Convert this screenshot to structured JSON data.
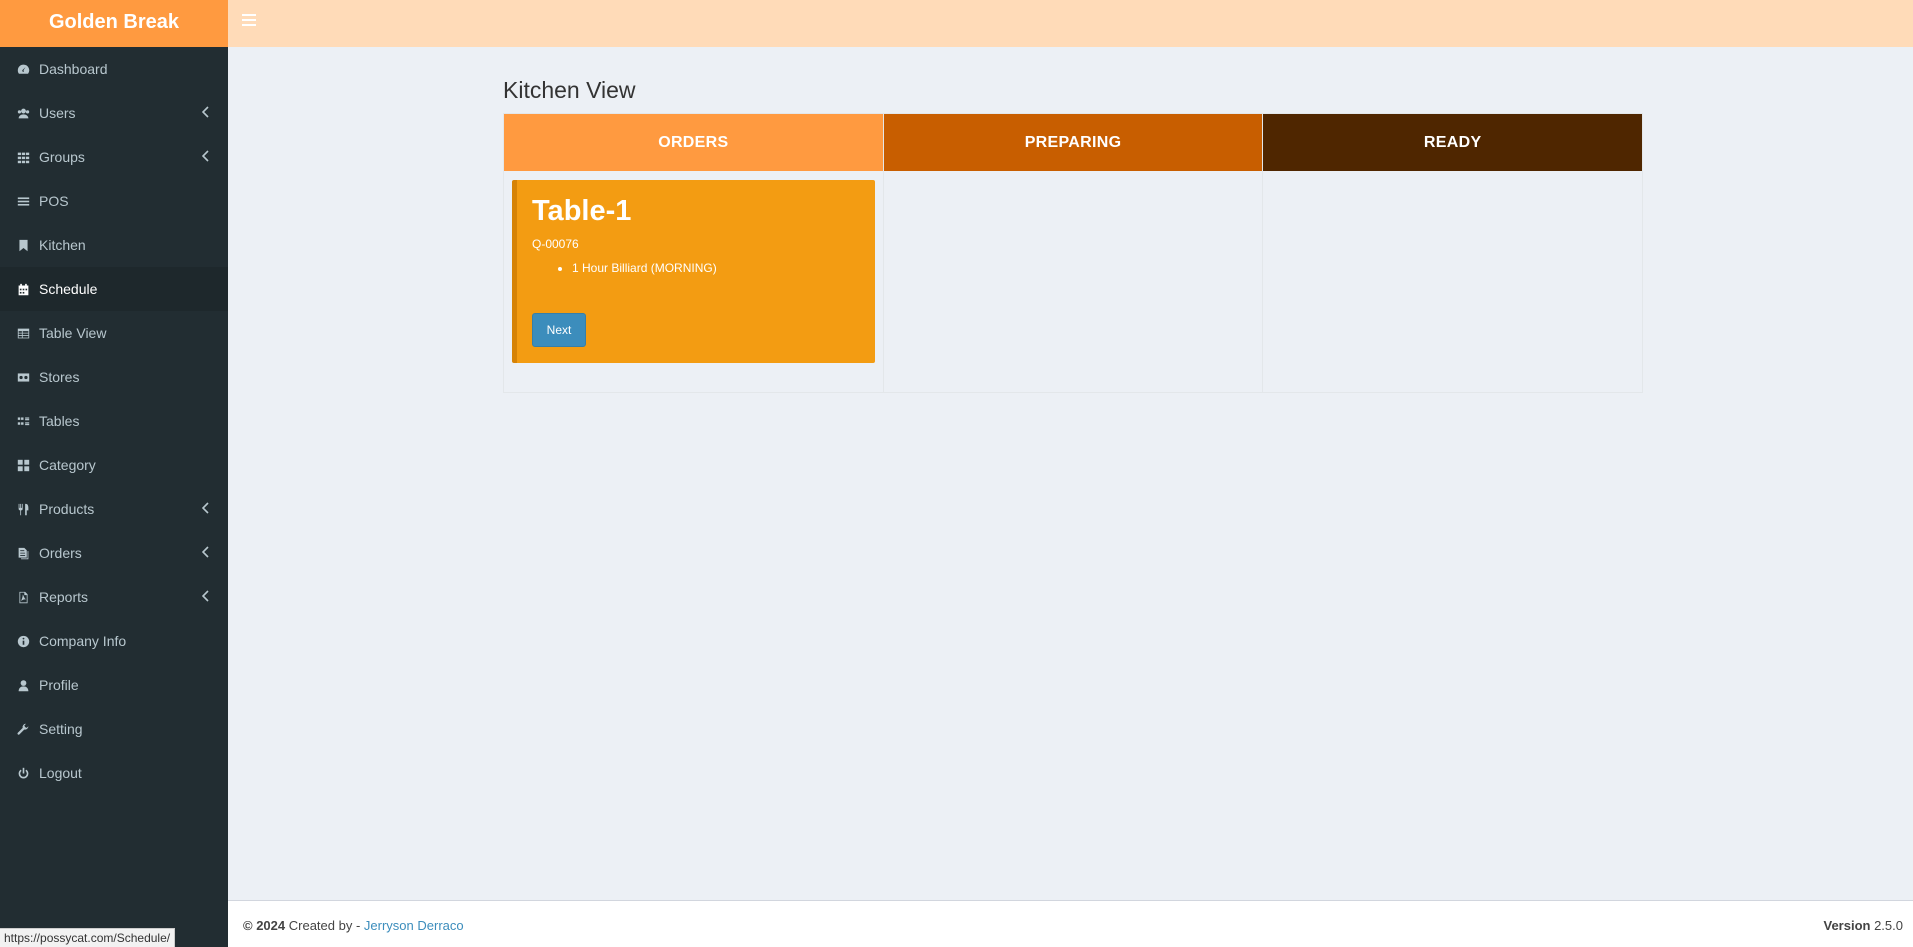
{
  "app": {
    "brand": "Golden Break"
  },
  "sidebar": {
    "items": [
      {
        "label": "Dashboard",
        "icon": "dashboard-icon",
        "has_caret": false,
        "active": false
      },
      {
        "label": "Users",
        "icon": "users-icon",
        "has_caret": true,
        "active": false
      },
      {
        "label": "Groups",
        "icon": "grid-icon",
        "has_caret": true,
        "active": false
      },
      {
        "label": "POS",
        "icon": "bars-icon",
        "has_caret": false,
        "active": false
      },
      {
        "label": "Kitchen",
        "icon": "bookmark-icon",
        "has_caret": false,
        "active": false
      },
      {
        "label": "Schedule",
        "icon": "calendar-icon",
        "has_caret": false,
        "active": true
      },
      {
        "label": "Table View",
        "icon": "table-icon",
        "has_caret": false,
        "active": false
      },
      {
        "label": "Stores",
        "icon": "store-icon",
        "has_caret": false,
        "active": false
      },
      {
        "label": "Tables",
        "icon": "tables-icon",
        "has_caret": false,
        "active": false
      },
      {
        "label": "Category",
        "icon": "category-icon",
        "has_caret": false,
        "active": false
      },
      {
        "label": "Products",
        "icon": "cutlery-icon",
        "has_caret": true,
        "active": false
      },
      {
        "label": "Orders",
        "icon": "files-icon",
        "has_caret": true,
        "active": false
      },
      {
        "label": "Reports",
        "icon": "pdf-file-icon",
        "has_caret": true,
        "active": false
      },
      {
        "label": "Company Info",
        "icon": "info-icon",
        "has_caret": false,
        "active": false
      },
      {
        "label": "Profile",
        "icon": "user-icon",
        "has_caret": false,
        "active": false
      },
      {
        "label": "Setting",
        "icon": "wrench-icon",
        "has_caret": false,
        "active": false
      },
      {
        "label": "Logout",
        "icon": "power-icon",
        "has_caret": false,
        "active": false
      }
    ]
  },
  "main": {
    "title": "Kitchen View",
    "columns": [
      {
        "label": "ORDERS",
        "color": "#ff9a40"
      },
      {
        "label": "PREPARING",
        "color": "#c85e00"
      },
      {
        "label": "READY",
        "color": "#4f2600"
      }
    ],
    "orders": [
      {
        "table": "Table-1",
        "code": "Q-00076",
        "items": [
          "1 Hour Billiard (MORNING)"
        ],
        "action": "Next"
      }
    ]
  },
  "footer": {
    "copyright": "© 2024",
    "created_by": "Created by -",
    "author": "Jerryson Derraco",
    "version_label": "Version",
    "version": "2.5.0"
  },
  "status_url": "https://possycat.com/Schedule/",
  "colors": {
    "sidebar": "#222d32",
    "brand": "#ff9a40",
    "topbar": "#ffdbb8",
    "card": "#f39c12",
    "button": "#3c8dbc"
  }
}
